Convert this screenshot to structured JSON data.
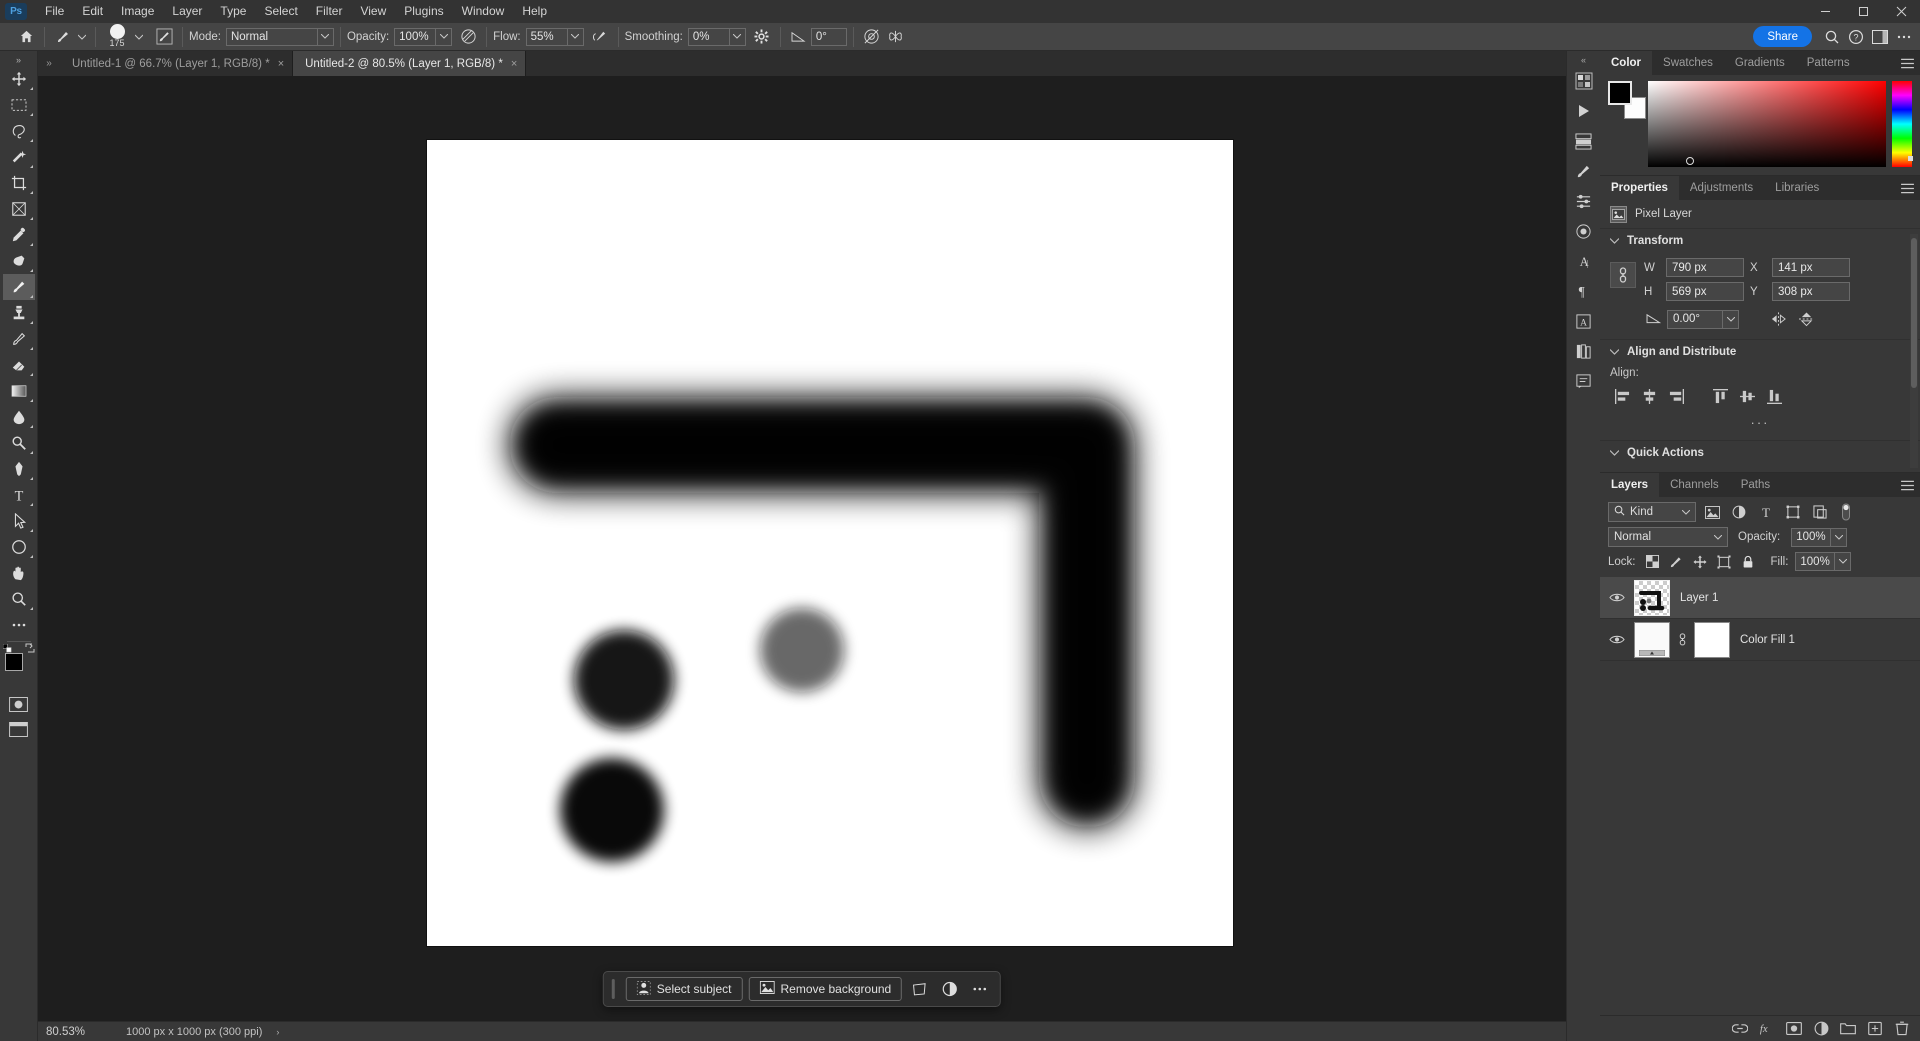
{
  "menubar": {
    "logo": "Ps",
    "items": [
      "File",
      "Edit",
      "Image",
      "Layer",
      "Type",
      "Select",
      "Filter",
      "View",
      "Plugins",
      "Window",
      "Help"
    ],
    "window_controls": [
      "minimize",
      "maximize",
      "close"
    ]
  },
  "options_bar": {
    "home_icon": "home-icon",
    "tool_icon": "brush-tool-icon",
    "brush_size": "175",
    "toggle_brush_panel": "toggle-brush-panel-icon",
    "mode_label": "Mode:",
    "mode_value": "Normal",
    "opacity_label": "Opacity:",
    "opacity_value": "100%",
    "pressure_opacity_icon": "pressure-opacity-icon",
    "flow_label": "Flow:",
    "flow_value": "55%",
    "airbrush_icon": "airbrush-icon",
    "smoothing_label": "Smoothing:",
    "smoothing_value": "0%",
    "smoothing_options_icon": "gear-icon",
    "angle_icon": "angle-icon",
    "angle_value": "0°",
    "pressure_size_icon": "pressure-size-icon",
    "symmetry_icon": "symmetry-butterfly-icon",
    "share_label": "Share",
    "search_icon": "search-icon",
    "help_icon": "help-icon",
    "workspace_icon": "workspace-icon",
    "more_icon": "more-icon"
  },
  "toolbar": {
    "expand_icon": "double-chevron-right-icon",
    "tools": [
      {
        "name": "move-tool",
        "glyph": "move"
      },
      {
        "name": "marquee-tool",
        "glyph": "marquee"
      },
      {
        "name": "lasso-tool",
        "glyph": "lasso"
      },
      {
        "name": "object-selection-tool",
        "glyph": "wand"
      },
      {
        "name": "crop-tool",
        "glyph": "crop"
      },
      {
        "name": "frame-tool",
        "glyph": "frame"
      },
      {
        "name": "eyedropper-tool",
        "glyph": "eyedropper"
      },
      {
        "name": "spot-healing-tool",
        "glyph": "healing"
      },
      {
        "name": "brush-tool",
        "glyph": "brush",
        "active": true
      },
      {
        "name": "clone-stamp-tool",
        "glyph": "stamp"
      },
      {
        "name": "history-brush-tool",
        "glyph": "history-brush"
      },
      {
        "name": "eraser-tool",
        "glyph": "eraser"
      },
      {
        "name": "gradient-tool",
        "glyph": "gradient"
      },
      {
        "name": "blur-tool",
        "glyph": "blur"
      },
      {
        "name": "dodge-tool",
        "glyph": "dodge"
      },
      {
        "name": "pen-tool",
        "glyph": "pen"
      },
      {
        "name": "type-tool",
        "glyph": "T"
      },
      {
        "name": "path-selection-tool",
        "glyph": "arrow"
      },
      {
        "name": "ellipse-tool",
        "glyph": "ellipse"
      },
      {
        "name": "hand-tool",
        "glyph": "hand"
      },
      {
        "name": "zoom-tool",
        "glyph": "zoom"
      },
      {
        "name": "edit-toolbar",
        "glyph": "ellipsis"
      }
    ],
    "foreground_color": "#000000",
    "background_color": "#ffffff",
    "quick_mask_icon": "quick-mask-icon",
    "screen_mode_icon": "screen-mode-icon"
  },
  "tabs": {
    "expand_icon": "double-chevron-right-icon",
    "items": [
      {
        "label": "Untitled-1 @ 66.7% (Layer 1, RGB/8) *",
        "active": false
      },
      {
        "label": "Untitled-2 @ 80.5% (Layer 1, RGB/8) *",
        "active": true
      }
    ],
    "close_glyph": "×"
  },
  "context_bar": {
    "select_subject": "Select subject",
    "select_subject_icon": "person-icon",
    "remove_background": "Remove background",
    "remove_background_icon": "image-icon",
    "transform_icon": "transform-icon",
    "adjustment_icon": "adjustment-half-circle-icon",
    "more_icon": "more-ellipsis-icon"
  },
  "statusbar": {
    "zoom": "80.53%",
    "doc_info": "1000 px x 1000 px (300 ppi)",
    "arrow": "›"
  },
  "right_rail": {
    "expand_icon": "double-chevron-left-icon",
    "icons": [
      "color-panel-icon",
      "play-actions-icon",
      "layers-comps-icon",
      "brush-settings-icon",
      "adjustments-icon",
      "styles-icon",
      "character-icon",
      "paragraph-icon",
      "glyphs-icon",
      "libraries-icon",
      "notes-icon"
    ]
  },
  "color_panel": {
    "tabs": [
      "Color",
      "Swatches",
      "Gradients",
      "Patterns"
    ],
    "active_tab": "Color",
    "menu_icon": "hamburger-menu-icon",
    "foreground": "#000000",
    "background": "#fdfdfd",
    "picker_base_color": "#ff0000"
  },
  "properties_panel": {
    "tabs": [
      "Properties",
      "Adjustments",
      "Libraries"
    ],
    "active_tab": "Properties",
    "menu_icon": "hamburger-menu-icon",
    "layer_type": "Pixel Layer",
    "layer_type_icon": "pixel-layer-icon",
    "transform": {
      "title": "Transform",
      "link_icon": "link-constrain-icon",
      "w_label": "W",
      "w_value": "790 px",
      "x_label": "X",
      "x_value": "141 px",
      "h_label": "H",
      "h_value": "569 px",
      "y_label": "Y",
      "y_value": "308 px",
      "angle_icon": "angle-icon",
      "angle_value": "0.00°",
      "flip_horizontal_icon": "flip-horizontal-icon",
      "flip_vertical_icon": "flip-vertical-icon"
    },
    "align": {
      "title": "Align and Distribute",
      "label": "Align:",
      "icons": [
        "align-left-icon",
        "align-horizontal-center-icon",
        "align-right-icon",
        "align-top-icon",
        "align-vertical-center-icon",
        "align-bottom-icon"
      ],
      "more": "···"
    },
    "quick_actions": {
      "title": "Quick Actions"
    }
  },
  "layers_panel": {
    "tabs": [
      "Layers",
      "Channels",
      "Paths"
    ],
    "active_tab": "Layers",
    "menu_icon": "hamburger-menu-icon",
    "filter": {
      "kind_label": "Kind",
      "search_icon": "search-icon",
      "filter_icons": [
        "pixel-filter-icon",
        "adjustment-filter-icon",
        "type-filter-icon",
        "shape-filter-icon",
        "smart-object-filter-icon"
      ],
      "toggle_icon": "filter-toggle-icon"
    },
    "blend_mode": "Normal",
    "opacity_label": "Opacity:",
    "opacity_value": "100%",
    "lock_label": "Lock:",
    "lock_icons": [
      "lock-transparent-pixels-icon",
      "lock-image-pixels-icon",
      "lock-position-icon",
      "lock-artboard-icon",
      "lock-all-icon"
    ],
    "fill_label": "Fill:",
    "fill_value": "100%",
    "layers": [
      {
        "name": "Layer 1",
        "visible": true,
        "selected": true,
        "type": "pixel"
      },
      {
        "name": "Color Fill 1",
        "visible": true,
        "selected": false,
        "type": "fill-with-mask"
      }
    ],
    "footer_icons": [
      "link-layers-icon",
      "layer-style-fx-icon",
      "add-mask-icon",
      "new-adjustment-layer-icon",
      "new-group-icon",
      "new-layer-icon",
      "delete-layer-icon"
    ]
  },
  "canvas": {
    "background": "#ffffff",
    "artwork_description": "black soft airbrush strokes: a large hook-shaped stroke, two filled circles, a gray circle, and a long horizontal rounded bar"
  }
}
